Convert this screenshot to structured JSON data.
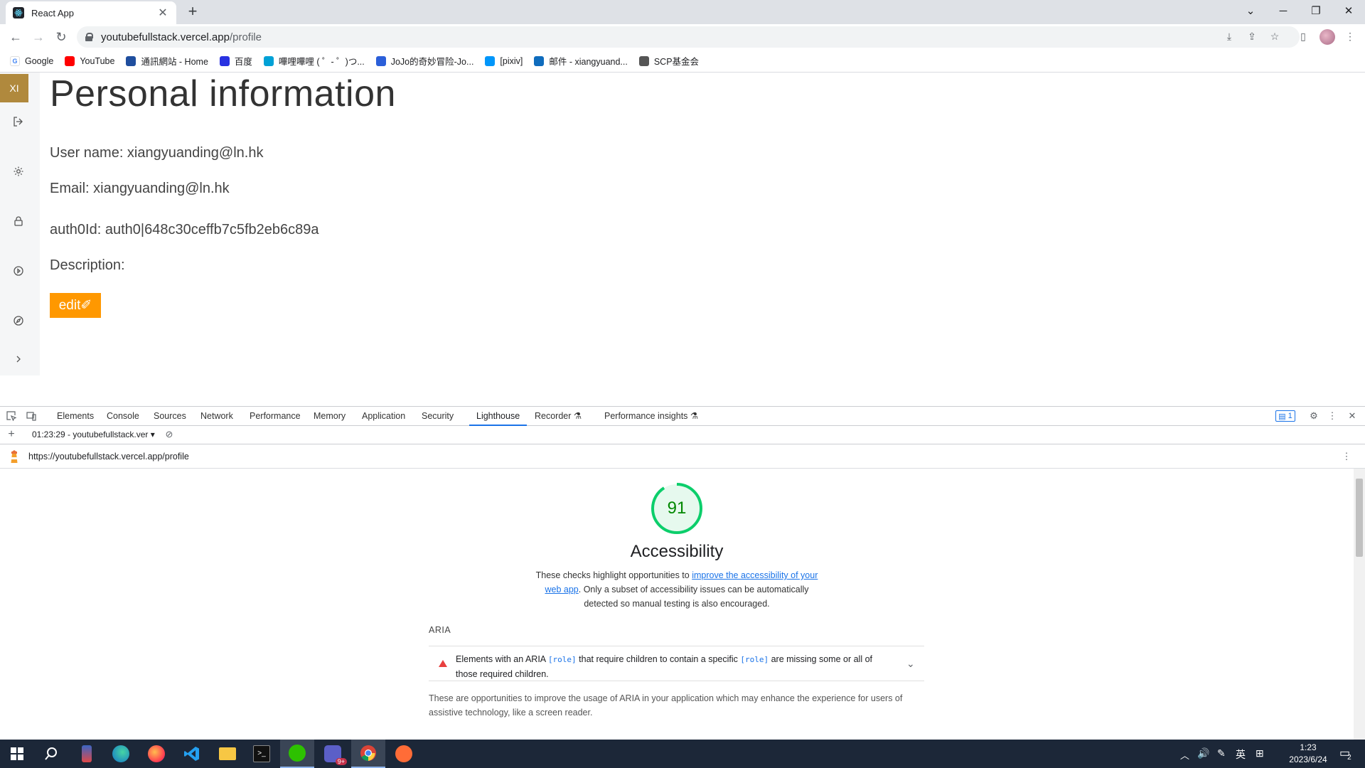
{
  "browser": {
    "tab_title": "React App",
    "url_host": "youtubefullstack.vercel.app",
    "url_path": "/profile",
    "bookmarks": [
      {
        "label": "Google",
        "color": "#ffffff"
      },
      {
        "label": "YouTube",
        "color": "#ff0000"
      },
      {
        "label": "通訊網站 - Home",
        "color": "#1f4e9e"
      },
      {
        "label": "百度",
        "color": "#2932e1"
      },
      {
        "label": "嗶哩嗶哩 ( ゜- ゜)つ...",
        "color": "#00a1d6"
      },
      {
        "label": "JoJo的奇妙冒险-Jo...",
        "color": "#2b5fd9"
      },
      {
        "label": "[pixiv]",
        "color": "#0096fa"
      },
      {
        "label": "邮件 - xiangyuand...",
        "color": "#0f6cbd"
      },
      {
        "label": "SCP基金会",
        "color": "#555555"
      }
    ]
  },
  "sidebar": {
    "avatar_initials": "XI"
  },
  "profile": {
    "title": "Personal information",
    "username_line": "User name: xiangyuanding@ln.hk",
    "email_line": "Email: xiangyuanding@ln.hk",
    "authid_line": "auth0Id: auth0|648c30ceffb7c5fb2eb6c89a",
    "description_line": "Description:",
    "edit_label": "edit✐"
  },
  "devtools": {
    "tabs": [
      "Elements",
      "Console",
      "Sources",
      "Network",
      "Performance",
      "Memory",
      "Application",
      "Security",
      "Lighthouse",
      "Recorder ⚗",
      "Performance insights ⚗"
    ],
    "active_tab": "Lighthouse",
    "issues_count": "1",
    "report_select": "01:23:29 - youtubefullstack.ver",
    "report_url": "https://youtubefullstack.vercel.app/profile",
    "lighthouse": {
      "score": 91,
      "score_color": "#0cce6b",
      "category": "Accessibility",
      "desc_pre": "These checks highlight opportunities to ",
      "desc_link": "improve the accessibility of your web app",
      "desc_post": ". Only a subset of accessibility issues can be automatically detected so manual testing is also encouraged.",
      "group_title": "ARIA",
      "audit_pre": "Elements with an ARIA ",
      "audit_code1": "[role]",
      "audit_mid": " that require children to contain a specific ",
      "audit_code2": "[role]",
      "audit_post": " are missing some or all of those required children.",
      "group_desc": "These are opportunities to improve the usage of ARIA in your application which may enhance the experience for users of assistive technology, like a screen reader."
    }
  },
  "taskbar": {
    "ime": "英",
    "time": "1:23",
    "date": "2023/6/24",
    "notif_count": "2",
    "notif_app_badge": "9+"
  }
}
